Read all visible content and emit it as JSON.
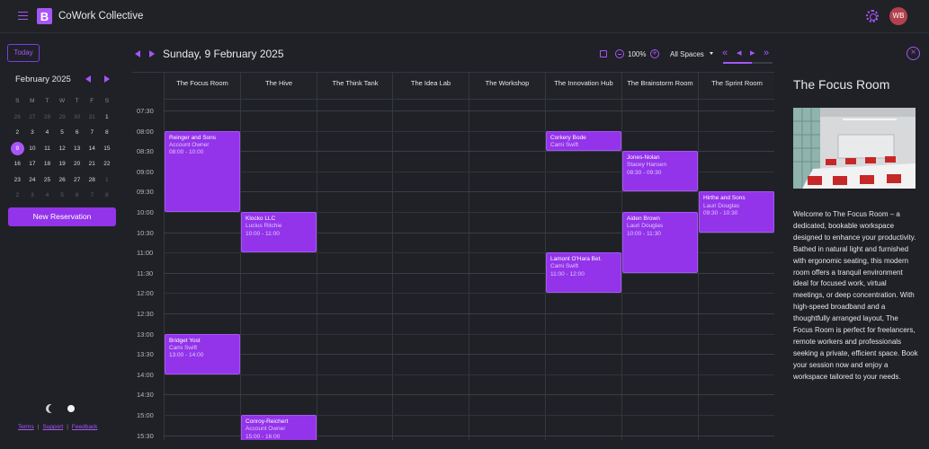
{
  "app": {
    "title": "CoWork Collective",
    "logo_letter": "B",
    "user_initials": "WB"
  },
  "sidebar": {
    "today_label": "Today",
    "month_label": "February 2025",
    "weekdays": [
      "S",
      "M",
      "T",
      "W",
      "T",
      "F",
      "S"
    ],
    "weeks": [
      [
        "26",
        "27",
        "28",
        "29",
        "30",
        "31",
        "1"
      ],
      [
        "2",
        "3",
        "4",
        "5",
        "6",
        "7",
        "8"
      ],
      [
        "9",
        "10",
        "11",
        "12",
        "13",
        "14",
        "15"
      ],
      [
        "16",
        "17",
        "18",
        "19",
        "20",
        "21",
        "22"
      ],
      [
        "23",
        "24",
        "25",
        "26",
        "27",
        "28",
        "1"
      ],
      [
        "2",
        "3",
        "4",
        "5",
        "6",
        "7",
        "8"
      ]
    ],
    "selected_day": "9",
    "new_reservation_label": "New Reservation",
    "footer": {
      "terms": "Terms",
      "support": "Support",
      "separator": "|",
      "feedback": "Feedback"
    }
  },
  "calendar": {
    "date_label": "Sunday, 9 February 2025",
    "zoom_label": "100%",
    "spaces_filter": "All Spaces",
    "rooms": [
      "The Focus Room",
      "The Hive",
      "The Think Tank",
      "The Idea Lab",
      "The Workshop",
      "The Innovation Hub",
      "The Brainstorm Room",
      "The Sprint Room"
    ],
    "times": [
      "07:30",
      "08:00",
      "08:30",
      "09:00",
      "09:30",
      "10:00",
      "10:30",
      "11:00",
      "11:30",
      "12:00",
      "12:30",
      "13:00",
      "13:30",
      "14:00",
      "14:30",
      "15:00",
      "15:30"
    ],
    "events": [
      {
        "room": 0,
        "start": 8.0,
        "end": 10.0,
        "title": "Reinger and Sons",
        "person": "Account Owner",
        "time": "08:00 - 10:00"
      },
      {
        "room": 0,
        "start": 13.0,
        "end": 14.0,
        "title": "Bridget Yost",
        "person": "Cami Swift",
        "time": "13:00 - 14:00"
      },
      {
        "room": 1,
        "start": 10.0,
        "end": 11.0,
        "title": "Klocko LLC",
        "person": "Lucius Ritchie",
        "time": "10:00 - 11:00"
      },
      {
        "room": 1,
        "start": 15.0,
        "end": 16.0,
        "title": "Conroy-Reichert",
        "person": "Account Owner",
        "time": "15:00 - 16:00"
      },
      {
        "room": 5,
        "start": 8.0,
        "end": 8.5,
        "title": "Corkery Bode",
        "person": "Cami Swift",
        "time": ""
      },
      {
        "room": 5,
        "start": 11.0,
        "end": 12.0,
        "title": "Lamont O'Hara Bet.",
        "person": "Cami Swift",
        "time": "11:00 - 12:00"
      },
      {
        "room": 6,
        "start": 8.5,
        "end": 9.5,
        "title": "Jones-Nolan",
        "person": "Stacey Hansen",
        "time": "08:30 - 09:30"
      },
      {
        "room": 6,
        "start": 10.0,
        "end": 11.5,
        "title": "Aiden Brown",
        "person": "Lauri Douglas",
        "time": "10:00 - 11:30"
      },
      {
        "room": 7,
        "start": 9.5,
        "end": 10.5,
        "title": "Hirthe and Sons",
        "person": "Lauri Douglas",
        "time": "09:30 - 10:30"
      }
    ]
  },
  "detail": {
    "room_title": "The Focus Room",
    "description": "Welcome to The Focus Room – a dedicated, bookable workspace designed to enhance your productivity. Bathed in natural light and furnished with ergonomic seating, this modern room offers a tranquil environment ideal for focused work, virtual meetings, or deep concentration. With high-speed broadband and a thoughtfully arranged layout, The Focus Room is perfect for freelancers, remote workers and professionals seeking a private, efficient space. Book your session now and enjoy a workspace tailored to your needs."
  },
  "colors": {
    "accent": "#a855f7",
    "event": "#9333ea",
    "background": "#1f2126",
    "avatar": "#b3404e"
  },
  "icons": [
    "menu-icon",
    "gear-icon",
    "calendar-icon",
    "zoom-out-icon",
    "zoom-in-icon",
    "close-icon",
    "moon-icon"
  ]
}
